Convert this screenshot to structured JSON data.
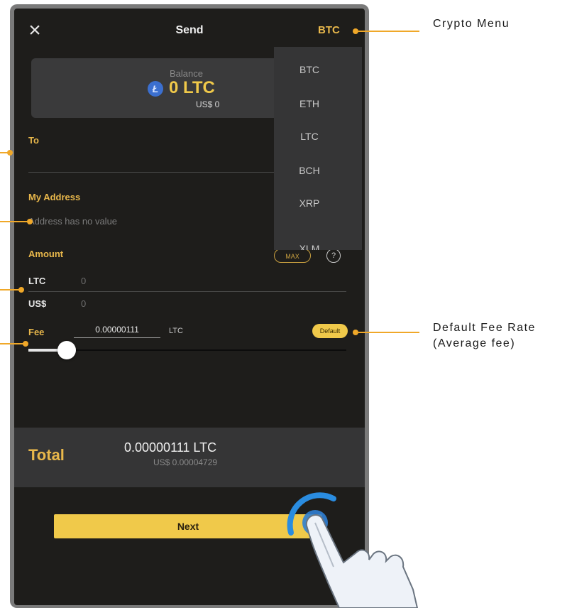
{
  "header": {
    "title": "Send",
    "selected_crypto": "BTC"
  },
  "balance": {
    "label": "Balance",
    "value": "0 LTC",
    "usd": "US$ 0",
    "coin_icon": "litecoin-icon"
  },
  "crypto_menu": {
    "options": [
      "BTC",
      "ETH",
      "LTC",
      "BCH",
      "XRP",
      "XLM"
    ]
  },
  "to": {
    "label": "To"
  },
  "my_address": {
    "label": "My Address",
    "placeholder": "Address has no value"
  },
  "amount": {
    "label": "Amount",
    "max_label": "MAX",
    "help_icon": "question-icon",
    "help_glyph": "?",
    "rows": [
      {
        "unit": "LTC",
        "value": "0"
      },
      {
        "unit": "US$",
        "value": "0"
      }
    ]
  },
  "fee": {
    "label": "Fee",
    "value": "0.00000111",
    "unit": "LTC",
    "default_label": "Default",
    "slider_level": 0.12
  },
  "total": {
    "label": "Total",
    "value": "0.00000111 LTC",
    "usd": "US$ 0.00004729"
  },
  "next_button": {
    "label": "Next"
  },
  "annotations": {
    "crypto_menu": "Crypto Menu",
    "default_fee_line1": "Default Fee Rate",
    "default_fee_line2": "(Average fee)"
  },
  "colors": {
    "accent": "#f0c94a",
    "callout": "#f0a829",
    "background": "#1e1d1b",
    "panel": "#353536"
  }
}
